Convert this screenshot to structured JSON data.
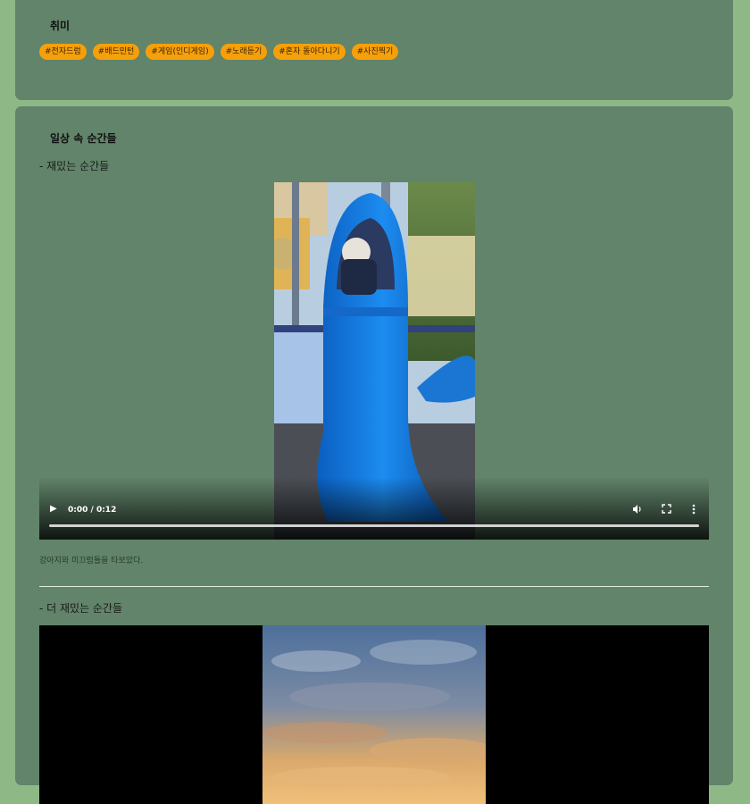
{
  "hobby": {
    "title": "취미",
    "tags": [
      "#전자드럼",
      "#배드민턴",
      "#게임(인디게임)",
      "#노래듣기",
      "#혼자 돌아다니기",
      "#사진찍기"
    ]
  },
  "moments": {
    "title": "일상 속 순간들",
    "section1": {
      "subtitle": "- 재밌는 순간들",
      "video_time": "0:00 / 0:12",
      "caption": "강아지와 미끄럼틀을 타보았다."
    },
    "section2": {
      "subtitle": "- 더 재밌는 순간들"
    }
  },
  "icons": {
    "play": "play-icon",
    "volume": "volume-icon",
    "fullscreen": "fullscreen-icon",
    "more": "more-vertical-icon"
  },
  "colors": {
    "page_bg": "#8fb887",
    "card_bg": "#61846a",
    "tag_bg": "#f5a00a"
  }
}
